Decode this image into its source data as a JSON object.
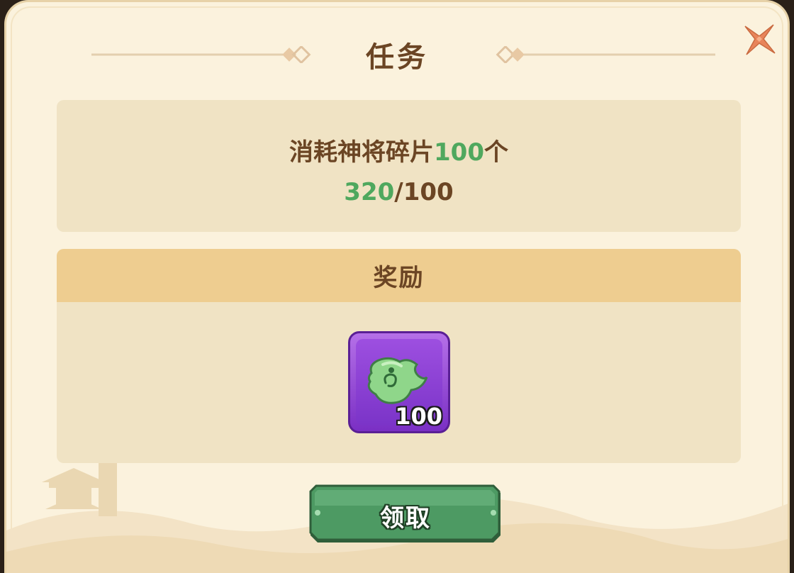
{
  "dialog": {
    "title": "任务",
    "close_icon": "close-x-icon"
  },
  "task": {
    "description_prefix": "消耗神将碎片",
    "description_amount": "100",
    "description_suffix": "个",
    "progress_current": "320",
    "progress_separator": "/",
    "progress_target": "100"
  },
  "reward": {
    "header": "奖励",
    "item_icon": "jade-fragment-icon",
    "item_count": "100"
  },
  "claim_button": {
    "label": "领取"
  },
  "colors": {
    "panel_bg": "#fbf2dd",
    "section_bg": "#f0e3c4",
    "reward_header_bg": "#eecd90",
    "text_brown": "#6b4524",
    "highlight_green": "#4fa85e",
    "item_purple": "#9d4fe0",
    "button_green": "#4d9a63",
    "close_orange": "#e8845a"
  }
}
